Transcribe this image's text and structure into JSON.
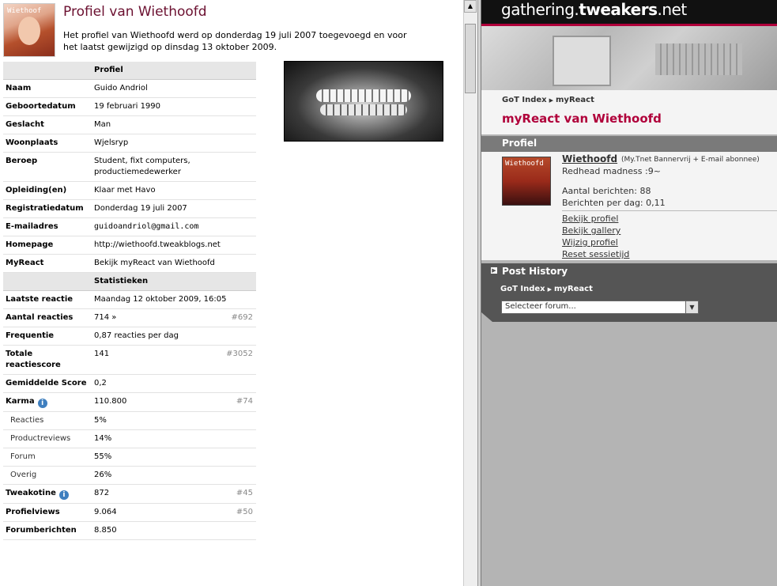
{
  "profile": {
    "title": "Profiel van Wiethoofd",
    "intro": "Het profiel van Wiethoofd werd op donderdag 19 juli 2007 toegevoegd en voor het laatst gewijzigd op dinsdag 13 oktober 2009.",
    "avatar_text": "Wiethoof"
  },
  "table": {
    "profiel_header": "Profiel",
    "statistieken_header": "Statistieken",
    "profiel_rows": [
      {
        "key": "Naam",
        "value": "Guido Andriol"
      },
      {
        "key": "Geboortedatum",
        "value": "19 februari 1990"
      },
      {
        "key": "Geslacht",
        "value": "Man"
      },
      {
        "key": "Woonplaats",
        "value": "Wjelsryp"
      },
      {
        "key": "Beroep",
        "value": "Student, fixt computers, productiemedewerker"
      },
      {
        "key": "Opleiding(en)",
        "value": "Klaar met Havo"
      },
      {
        "key": "Registratiedatum",
        "value": "Donderdag 19 juli 2007"
      },
      {
        "key": "E-mailadres",
        "value": "guidoandriol@gmail.com"
      },
      {
        "key": "Homepage",
        "value": "http://wiethoofd.tweakblogs.net"
      },
      {
        "key": "MyReact",
        "value": "Bekijk myReact van Wiethoofd"
      }
    ],
    "stat_rows": [
      {
        "key": "Laatste reactie",
        "value": "Maandag 12 oktober 2009, 16:05",
        "rank": ""
      },
      {
        "key": "Aantal reacties",
        "value": "714 »",
        "rank": "#692"
      },
      {
        "key": "Frequentie",
        "value": "0,87 reacties per dag",
        "rank": ""
      },
      {
        "key": "Totale reactiescore",
        "value": "141",
        "rank": "#3052"
      },
      {
        "key": "Gemiddelde Score",
        "value": "0,2",
        "rank": ""
      },
      {
        "key": "Karma",
        "value": "110.800",
        "rank": "#74"
      },
      {
        "key": "Reacties",
        "value": "5%",
        "rank": ""
      },
      {
        "key": "Productreviews",
        "value": "14%",
        "rank": ""
      },
      {
        "key": "Forum",
        "value": "55%",
        "rank": ""
      },
      {
        "key": "Overig",
        "value": "26%",
        "rank": ""
      },
      {
        "key": "Tweakotine",
        "value": "872",
        "rank": "#45"
      },
      {
        "key": "Profielviews",
        "value": "9.064",
        "rank": "#50"
      },
      {
        "key": "Forumberichten",
        "value": "8.850",
        "rank": ""
      }
    ]
  },
  "right": {
    "logo_prefix": "gathering.",
    "logo_bold": "tweakers",
    "logo_suffix": ".net",
    "crumb_root": "GoT Index",
    "crumb_leaf": "myReact",
    "page_title": "myReact van Wiethoofd",
    "profiel_label": "Profiel",
    "user_name": "Wiethoofd",
    "user_status": "(My.Tnet Bannervrij + E-mail abonnee)",
    "avatar_text": "Wiethoofd",
    "motto": "Redhead madness :9~",
    "posts": "Aantal berichten: 88",
    "per_day": "Berichten per dag: 0,11",
    "links": [
      "Bekijk profiel",
      "Bekijk gallery",
      "Wijzig profiel",
      "Reset sessietijd"
    ],
    "history_label": "Post History",
    "forum_select_value": "Selecteer forum..."
  }
}
